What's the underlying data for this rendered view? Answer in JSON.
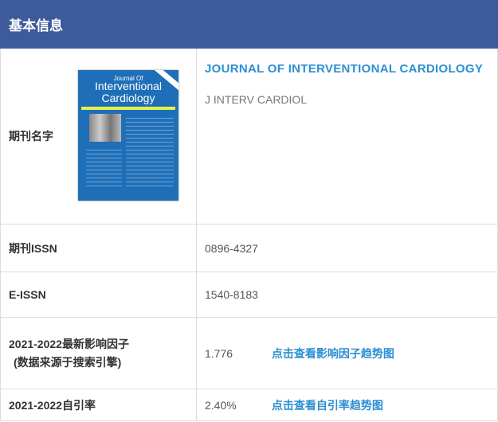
{
  "header": {
    "title": "基本信息"
  },
  "rows": {
    "name": {
      "label": "期刊名字",
      "full_title": "JOURNAL OF INTERVENTIONAL CARDIOLOGY",
      "abbr": "J INTERV CARDIOL",
      "cover": {
        "line1": "Journal Of",
        "line2": "Interventional Cardiology"
      }
    },
    "issn": {
      "label": "期刊ISSN",
      "value": "0896-4327"
    },
    "eissn": {
      "label": "E-ISSN",
      "value": "1540-8183"
    },
    "if": {
      "label": "2021-2022最新影响因子",
      "label2": "(数据来源于搜索引擎)",
      "value": "1.776",
      "link": "点击查看影响因子趋势图"
    },
    "self": {
      "label": "2021-2022自引率",
      "value": "2.40%",
      "link": "点击查看自引率趋势图"
    }
  },
  "colors": {
    "header": "#3d5a9b",
    "link": "#2b8fd2"
  }
}
